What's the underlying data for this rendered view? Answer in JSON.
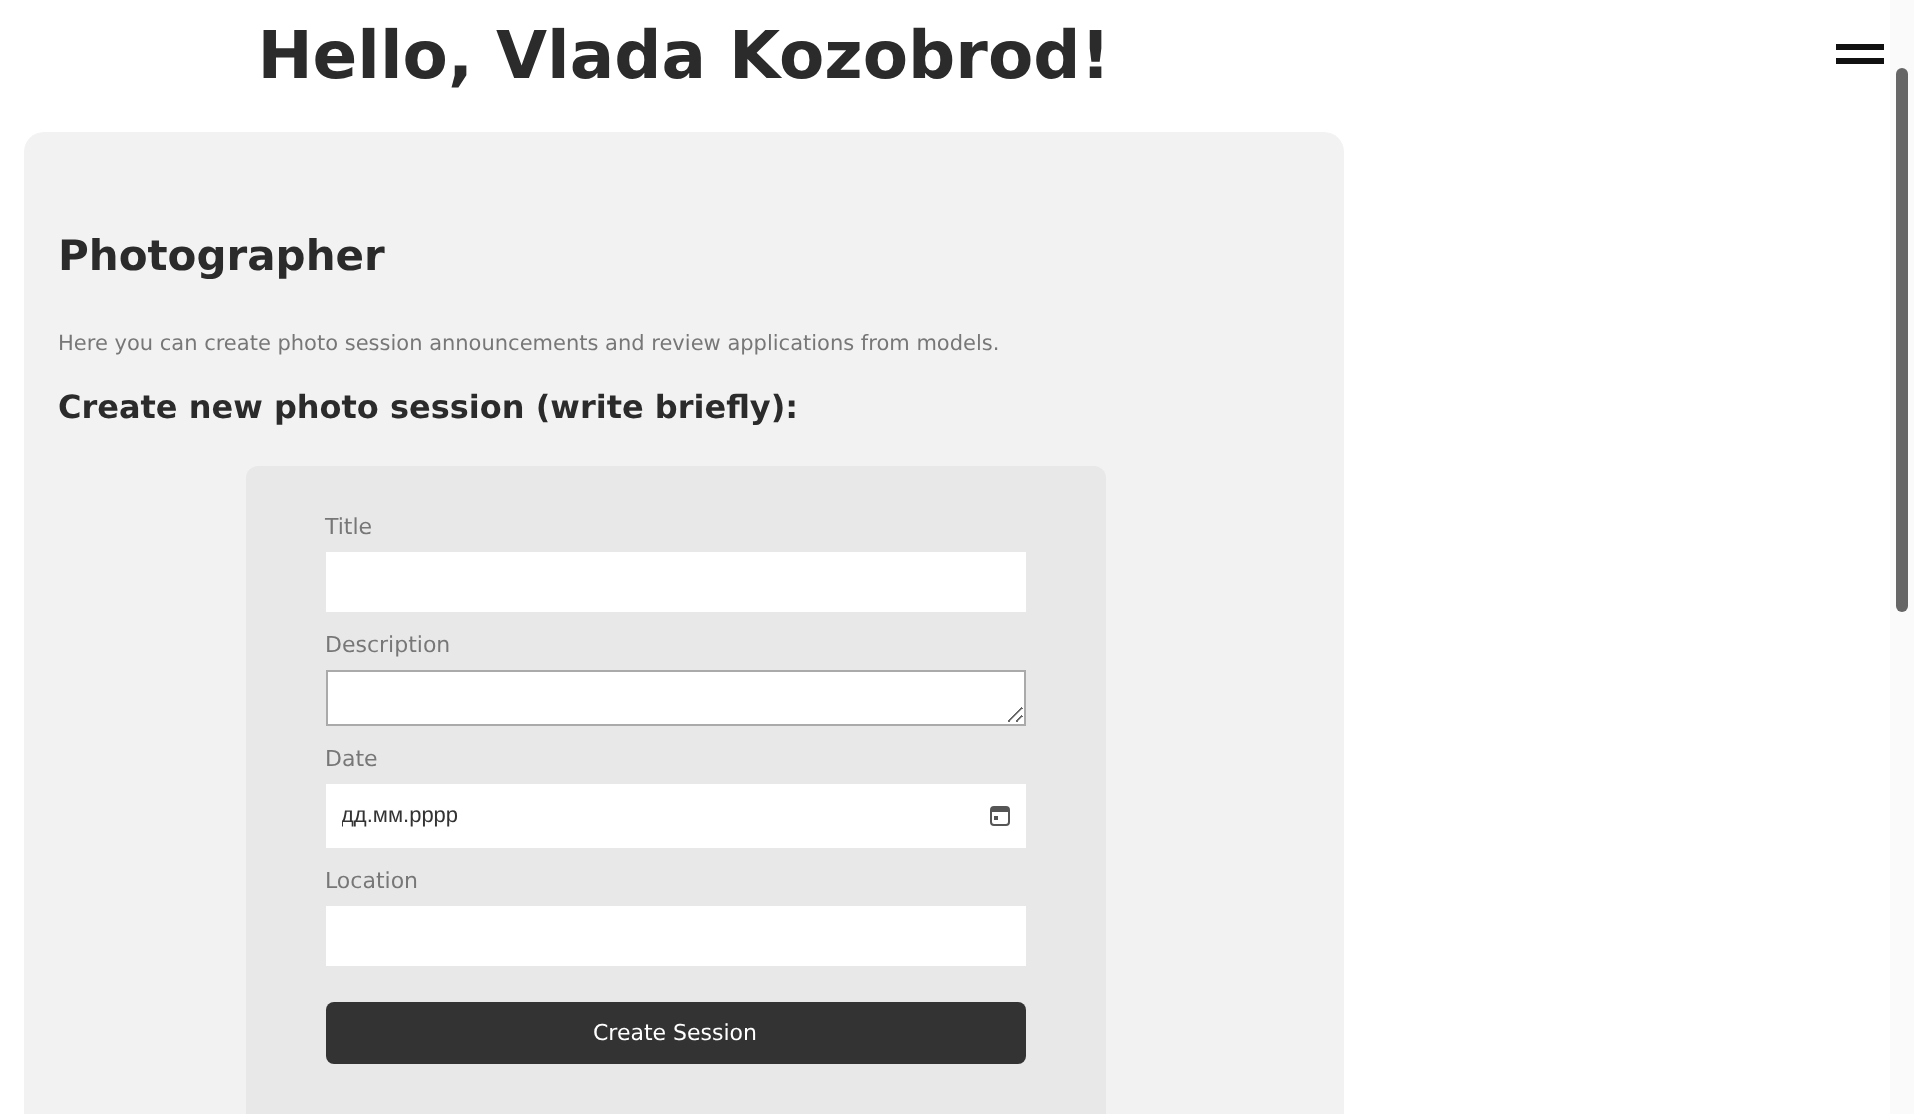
{
  "greeting": "Hello, Vlada Kozobrod!",
  "card": {
    "title": "Photographer",
    "description": "Here you can create photo session announcements and review applications from models.",
    "form_title": "Create new photo session (write briefly):"
  },
  "form": {
    "fields": [
      {
        "label": "Title",
        "kind": "text"
      },
      {
        "label": "Description",
        "kind": "textarea"
      },
      {
        "label": "Date",
        "kind": "date",
        "placeholder": "дд.мм.рррр"
      },
      {
        "label": "Location",
        "kind": "text"
      }
    ],
    "submit": "Create Session"
  }
}
